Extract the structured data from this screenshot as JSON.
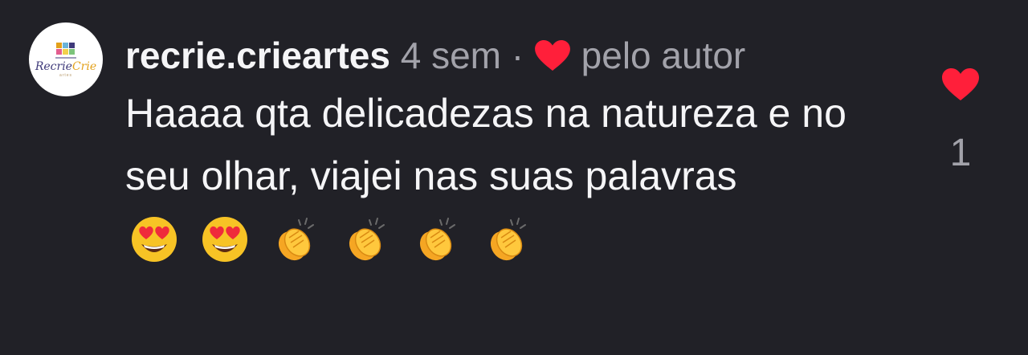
{
  "comment": {
    "avatar": {
      "name": "avatar",
      "line1_a": "Recrie",
      "line1_b": "Crie",
      "line2": "artes"
    },
    "username": "recrie.crieartes",
    "timestamp": "4 sem",
    "separator": "·",
    "liked_by_author_icon": "heart-icon",
    "liked_by_author_text": "pelo autor",
    "text": "Haaaa qta delicadezas na natureza e no seu olhar, viajei nas suas palavras",
    "emojis": [
      "heart-eyes-emoji",
      "heart-eyes-emoji",
      "clapping-hands-emoji",
      "clapping-hands-emoji",
      "clapping-hands-emoji",
      "clapping-hands-emoji"
    ],
    "like_count": "1"
  },
  "colors": {
    "background": "#212127",
    "primary_text": "#f5f5f7",
    "secondary_text": "#a2a2aa",
    "heart": "#ff1f3a"
  }
}
